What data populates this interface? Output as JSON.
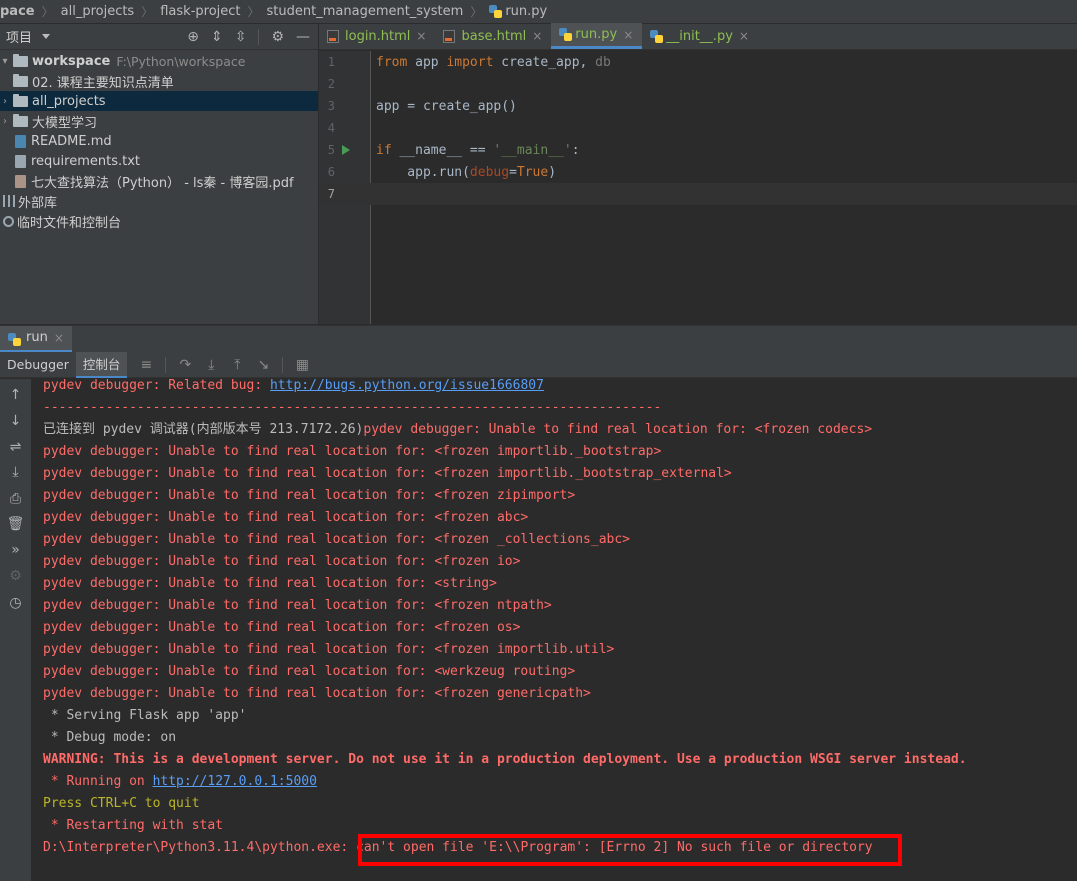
{
  "breadcrumb": {
    "items": [
      "pace",
      "all_projects",
      "flask-project",
      "student_management_system"
    ],
    "file": "run.py"
  },
  "project_panel": {
    "title": "项目",
    "tree": {
      "workspace": {
        "label": "workspace",
        "path": "F:\\Python\\workspace"
      },
      "folder_course": "02. 课程主要知识点清单",
      "folder_all_projects": "all_projects",
      "folder_llm": "大模型学习",
      "file_readme": "README.md",
      "file_requirements": "requirements.txt",
      "file_pdf": "七大查找算法（Python） - ls秦 - 博客园.pdf",
      "external_libs": "外部库",
      "scratches": "临时文件和控制台"
    }
  },
  "editor": {
    "tabs": [
      {
        "label": "login.html",
        "active": false
      },
      {
        "label": "base.html",
        "active": false
      },
      {
        "label": "run.py",
        "active": true
      },
      {
        "label": "__init__.py",
        "active": false
      }
    ],
    "line_numbers": [
      "1",
      "2",
      "3",
      "4",
      "5",
      "6",
      "7"
    ],
    "current_line": 7
  },
  "run_window": {
    "tab_label": "run",
    "subtabs": {
      "debugger": "Debugger",
      "console": "控制台"
    },
    "console": {
      "l1_prefix": "pydev debugger: Related bug: ",
      "l1_link": "http://bugs.python.org/issue1666807",
      "l2": "-------------------------------------------------------------------------------",
      "l3_prefix": "已连接到 pydev 调试器(内部版本号 213.7172.26)",
      "l3_suffix": "pydev debugger: Unable to find real location for: <frozen codecs>",
      "unable_lines": [
        "pydev debugger: Unable to find real location for: <frozen importlib._bootstrap>",
        "pydev debugger: Unable to find real location for: <frozen importlib._bootstrap_external>",
        "pydev debugger: Unable to find real location for: <frozen zipimport>",
        "pydev debugger: Unable to find real location for: <frozen abc>",
        "pydev debugger: Unable to find real location for: <frozen _collections_abc>",
        "pydev debugger: Unable to find real location for: <frozen io>",
        "pydev debugger: Unable to find real location for: <string>",
        "pydev debugger: Unable to find real location for: <frozen ntpath>",
        "pydev debugger: Unable to find real location for: <frozen os>",
        "pydev debugger: Unable to find real location for: <frozen importlib.util>",
        "pydev debugger: Unable to find real location for: <werkzeug routing>",
        "pydev debugger: Unable to find real location for: <frozen genericpath>"
      ],
      "serving": " * Serving Flask app 'app'",
      "debug_mode": " * Debug mode: on",
      "warning": "WARNING: This is a development server. Do not use it in a production deployment. Use a production WSGI server instead.",
      "running_prefix": " * Running on ",
      "running_link": "http://127.0.0.1:5000",
      "press_quit": "Press CTRL+C to quit",
      "restarting": " * Restarting with stat",
      "interp": "D:\\Interpreter\\Python3.11.4\\python.exe: ",
      "error": "can't open file 'E:\\\\Program': [Errno 2] No such file or directory"
    }
  },
  "colors": {
    "background": "#2b2b2b",
    "panel": "#3c3f41",
    "error_text": "#ff6b68",
    "link": "#589df6",
    "highlight_box": "#ff0000"
  }
}
